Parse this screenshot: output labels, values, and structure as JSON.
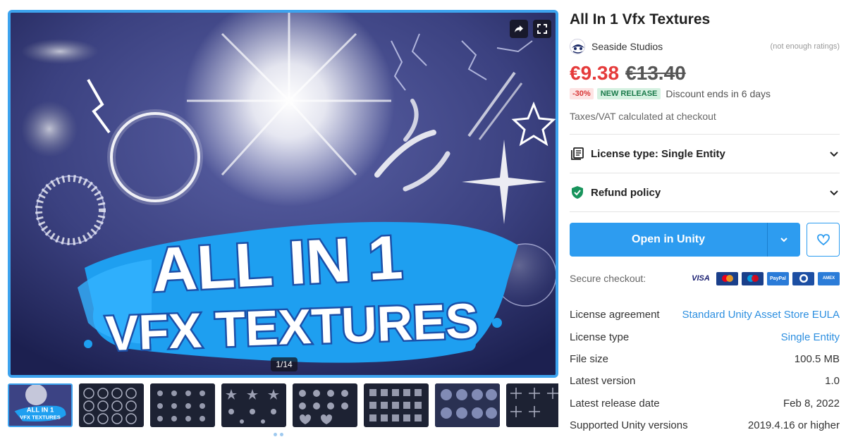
{
  "gallery": {
    "main_image_text_line1": "ALL IN 1",
    "main_image_text_line2": "VFX TEXTURES",
    "counter": "1/14",
    "thumb_text_line1": "ALL IN 1",
    "thumb_text_line2": "VFX TEXTURES",
    "thumbnail_count": 8,
    "share_icon": "share-icon",
    "fullscreen_icon": "fullscreen-icon"
  },
  "product": {
    "title": "All In 1 Vfx Textures",
    "publisher": "Seaside Studios",
    "ratings": "(not enough ratings)",
    "price": "€9.38",
    "old_price": "€13.40",
    "discount_badge": "-30%",
    "new_release_badge": "NEW RELEASE",
    "discount_ends": "Discount ends in 6 days",
    "tax_note": "Taxes/VAT calculated at checkout"
  },
  "accordions": [
    {
      "label": "License type: Single Entity",
      "icon": "license-icon"
    },
    {
      "label": "Refund policy",
      "icon": "shield-check-icon"
    }
  ],
  "actions": {
    "open_in_unity": "Open in Unity",
    "dropdown_icon": "chevron-down-icon",
    "favorite_icon": "heart-icon"
  },
  "checkout": {
    "label": "Secure checkout:",
    "methods": [
      "VISA",
      "Mastercard",
      "Maestro",
      "PayPal",
      "Diners",
      "AMEX"
    ]
  },
  "details": [
    {
      "key": "License agreement",
      "value": "Standard Unity Asset Store EULA",
      "link": true
    },
    {
      "key": "License type",
      "value": "Single Entity",
      "link": true
    },
    {
      "key": "File size",
      "value": "100.5 MB",
      "link": false
    },
    {
      "key": "Latest version",
      "value": "1.0",
      "link": false
    },
    {
      "key": "Latest release date",
      "value": "Feb 8, 2022",
      "link": false
    },
    {
      "key": "Supported Unity versions",
      "value": "2019.4.16 or higher",
      "link": false
    }
  ],
  "colors": {
    "accent": "#2d9cf0",
    "sale_price": "#e53a3a",
    "link": "#2d8fe0"
  }
}
